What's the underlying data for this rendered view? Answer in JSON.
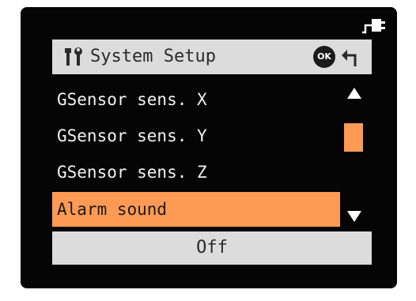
{
  "header": {
    "icon": "tools-icon",
    "title": "System Setup",
    "ok_label": "OK",
    "back_icon": "back-arrow-icon"
  },
  "status": {
    "power_icon": "power-plug-icon"
  },
  "menu": {
    "items": [
      {
        "label": "GSensor sens. X",
        "selected": false
      },
      {
        "label": "GSensor sens. Y",
        "selected": false
      },
      {
        "label": "GSensor sens. Z",
        "selected": false
      },
      {
        "label": "Alarm sound",
        "selected": true
      }
    ]
  },
  "value": {
    "current": "Off"
  },
  "scrollbar": {
    "up_icon": "scroll-up-arrow-icon",
    "down_icon": "scroll-down-arrow-icon"
  },
  "colors": {
    "screen_background": "#050505",
    "bar_background": "#dcdcdc",
    "highlight": "#ff9a55",
    "text_light": "#f2f2f2",
    "text_dark": "#2a2a2a"
  }
}
